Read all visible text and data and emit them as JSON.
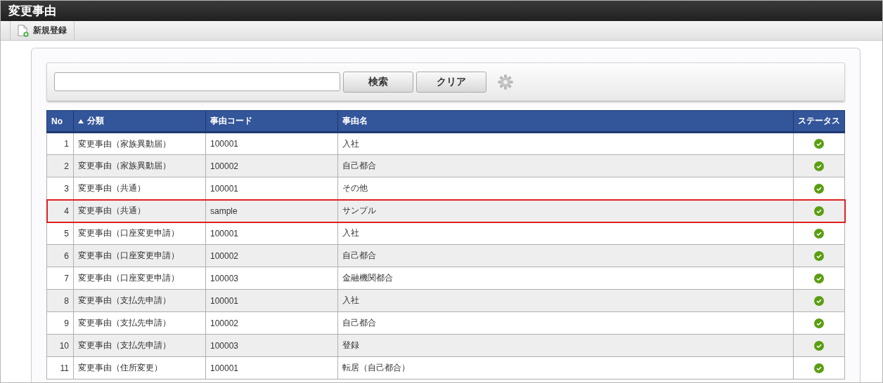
{
  "window": {
    "title": "変更事由"
  },
  "toolbar": {
    "new_button": "新規登録"
  },
  "search": {
    "buttons": [
      "検索",
      "クリア"
    ]
  },
  "table": {
    "columns": [
      {
        "label": "No",
        "sorted": false
      },
      {
        "label": "分類",
        "sorted": true
      },
      {
        "label": "事由コード",
        "sorted": false
      },
      {
        "label": "事由名",
        "sorted": false
      },
      {
        "label": "ステータス",
        "sorted": false
      }
    ],
    "rows": [
      {
        "no": "1",
        "category": "変更事由（家族異動届）",
        "code": "100001",
        "name": "入社",
        "active": true,
        "highlighted": false
      },
      {
        "no": "2",
        "category": "変更事由（家族異動届）",
        "code": "100002",
        "name": "自己都合",
        "active": true,
        "highlighted": false
      },
      {
        "no": "3",
        "category": "変更事由（共通）",
        "code": "100001",
        "name": "その他",
        "active": true,
        "highlighted": false
      },
      {
        "no": "4",
        "category": "変更事由（共通）",
        "code": "sample",
        "name": "サンプル",
        "active": true,
        "highlighted": true
      },
      {
        "no": "5",
        "category": "変更事由（口座変更申請）",
        "code": "100001",
        "name": "入社",
        "active": true,
        "highlighted": false
      },
      {
        "no": "6",
        "category": "変更事由（口座変更申請）",
        "code": "100002",
        "name": "自己都合",
        "active": true,
        "highlighted": false
      },
      {
        "no": "7",
        "category": "変更事由（口座変更申請）",
        "code": "100003",
        "name": "金融機関都合",
        "active": true,
        "highlighted": false
      },
      {
        "no": "8",
        "category": "変更事由（支払先申請）",
        "code": "100001",
        "name": "入社",
        "active": true,
        "highlighted": false
      },
      {
        "no": "9",
        "category": "変更事由（支払先申請）",
        "code": "100002",
        "name": "自己都合",
        "active": true,
        "highlighted": false
      },
      {
        "no": "10",
        "category": "変更事由（支払先申請）",
        "code": "100003",
        "name": "登録",
        "active": true,
        "highlighted": false
      },
      {
        "no": "11",
        "category": "変更事由（住所変更）",
        "code": "100001",
        "name": "転居（自己都合）",
        "active": true,
        "highlighted": false
      }
    ]
  }
}
